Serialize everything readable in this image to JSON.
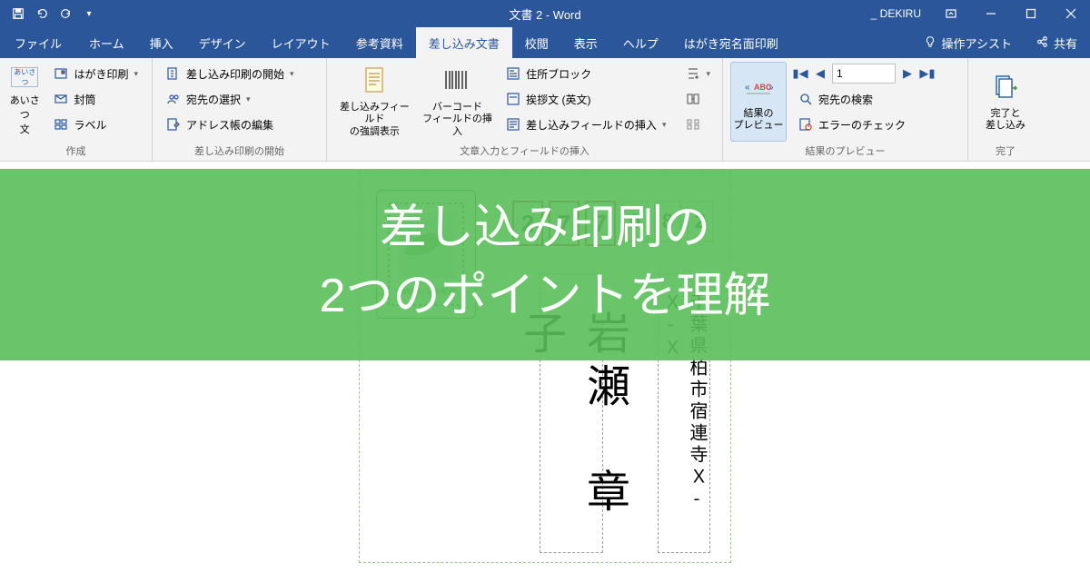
{
  "title": "文書 2  -  Word",
  "user": "_ DEKIRU",
  "tabs": {
    "file": "ファイル",
    "home": "ホーム",
    "insert": "挿入",
    "design": "デザイン",
    "layout": "レイアウト",
    "references": "参考資料",
    "mailings": "差し込み文書",
    "review": "校閲",
    "view": "表示",
    "help": "ヘルプ",
    "hagaki": "はがき宛名面印刷"
  },
  "tell_me": "操作アシスト",
  "share": "共有",
  "groups": {
    "create": {
      "label": "作成",
      "greeting": "あいさつ\n文",
      "hagaki_print": "はがき印刷",
      "envelope": "封筒",
      "labels": "ラベル"
    },
    "start": {
      "label": "差し込み印刷の開始",
      "start_merge": "差し込み印刷の開始",
      "select_recipients": "宛先の選択",
      "edit_list": "アドレス帳の編集"
    },
    "write": {
      "label": "文章入力とフィールドの挿入",
      "highlight": "差し込みフィールド\nの強調表示",
      "barcode": "バーコード\nフィールドの挿入",
      "address_block": "住所ブロック",
      "greeting_line": "挨拶文 (英文)",
      "insert_field": "差し込みフィールドの挿入"
    },
    "preview": {
      "label": "結果のプレビュー",
      "preview_btn": "結果の\nプレビュー",
      "record_value": "1",
      "find_recipient": "宛先の検索",
      "check_errors": "エラーのチェック"
    },
    "finish": {
      "label": "完了",
      "finish_merge": "完了と\n差し込み"
    }
  },
  "postcard": {
    "postal": [
      "2",
      "7",
      "7",
      "0",
      "8",
      "2"
    ],
    "address": "千葉県柏市宿連寺Ｘ-Ｘ-Ｘ",
    "name": "岩瀬　章子"
  },
  "overlay": {
    "line1": "差し込み印刷の",
    "line2": "2つのポイントを理解"
  }
}
